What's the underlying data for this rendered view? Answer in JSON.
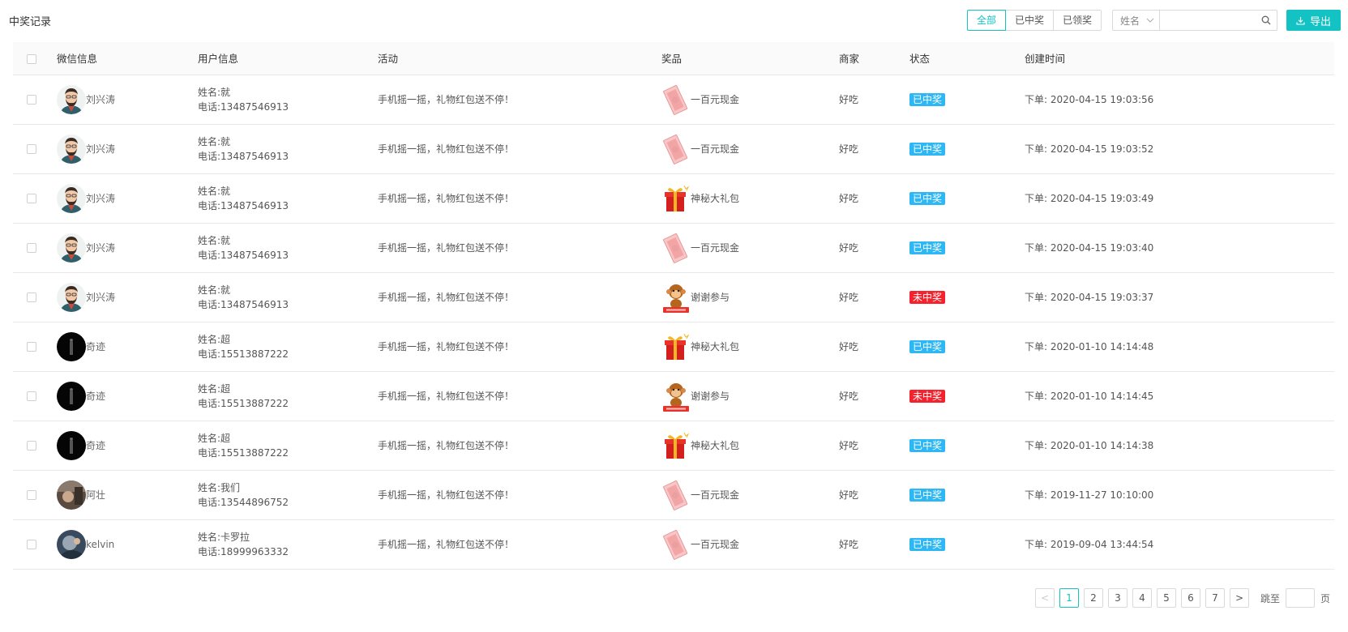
{
  "page": {
    "title": "中奖记录"
  },
  "filters": {
    "all": "全部",
    "won": "已中奖",
    "claimed": "已领奖"
  },
  "search": {
    "field_label": "姓名",
    "value": ""
  },
  "export_label": "导出",
  "table": {
    "headers": [
      "微信信息",
      "用户信息",
      "活动",
      "奖品",
      "商家",
      "状态",
      "创建时间"
    ],
    "rows": [
      {
        "wx_name": "刘兴涛",
        "avatar": "bearded-man",
        "name": "姓名:就",
        "phone": "电话:13487546913",
        "activity": "手机摇一摇，礼物红包送不停！",
        "prize": "一百元现金",
        "prize_icon": "cash-icon",
        "merchant": "好吃",
        "status": "已中奖",
        "status_type": "win",
        "time": "下单: 2020-04-15 19:03:56"
      },
      {
        "wx_name": "刘兴涛",
        "avatar": "bearded-man",
        "name": "姓名:就",
        "phone": "电话:13487546913",
        "activity": "手机摇一摇，礼物红包送不停！",
        "prize": "一百元现金",
        "prize_icon": "cash-icon",
        "merchant": "好吃",
        "status": "已中奖",
        "status_type": "win",
        "time": "下单: 2020-04-15 19:03:52"
      },
      {
        "wx_name": "刘兴涛",
        "avatar": "bearded-man",
        "name": "姓名:就",
        "phone": "电话:13487546913",
        "activity": "手机摇一摇，礼物红包送不停！",
        "prize": "神秘大礼包",
        "prize_icon": "gift-icon",
        "merchant": "好吃",
        "status": "已中奖",
        "status_type": "win",
        "time": "下单: 2020-04-15 19:03:49"
      },
      {
        "wx_name": "刘兴涛",
        "avatar": "bearded-man",
        "name": "姓名:就",
        "phone": "电话:13487546913",
        "activity": "手机摇一摇，礼物红包送不停！",
        "prize": "一百元现金",
        "prize_icon": "cash-icon",
        "merchant": "好吃",
        "status": "已中奖",
        "status_type": "win",
        "time": "下单: 2020-04-15 19:03:40"
      },
      {
        "wx_name": "刘兴涛",
        "avatar": "bearded-man",
        "name": "姓名:就",
        "phone": "电话:13487546913",
        "activity": "手机摇一摇，礼物红包送不停！",
        "prize": "谢谢参与",
        "prize_icon": "monkey-icon",
        "merchant": "好吃",
        "status": "未中奖",
        "status_type": "lose",
        "time": "下单: 2020-04-15 19:03:37"
      },
      {
        "wx_name": "奇迹",
        "avatar": "dark",
        "name": "姓名:超",
        "phone": "电话:15513887222",
        "activity": "手机摇一摇，礼物红包送不停！",
        "prize": "神秘大礼包",
        "prize_icon": "gift-icon",
        "merchant": "好吃",
        "status": "已中奖",
        "status_type": "win",
        "time": "下单: 2020-01-10 14:14:48"
      },
      {
        "wx_name": "奇迹",
        "avatar": "dark",
        "name": "姓名:超",
        "phone": "电话:15513887222",
        "activity": "手机摇一摇，礼物红包送不停！",
        "prize": "谢谢参与",
        "prize_icon": "monkey-icon",
        "merchant": "好吃",
        "status": "未中奖",
        "status_type": "lose",
        "time": "下单: 2020-01-10 14:14:45"
      },
      {
        "wx_name": "奇迹",
        "avatar": "dark",
        "name": "姓名:超",
        "phone": "电话:15513887222",
        "activity": "手机摇一摇，礼物红包送不停！",
        "prize": "神秘大礼包",
        "prize_icon": "gift-icon",
        "merchant": "好吃",
        "status": "已中奖",
        "status_type": "win",
        "time": "下单: 2020-01-10 14:14:38"
      },
      {
        "wx_name": "阿壮",
        "avatar": "photo-brown",
        "name": "姓名:我们",
        "phone": "电话:13544896752",
        "activity": "手机摇一摇，礼物红包送不停！",
        "prize": "一百元现金",
        "prize_icon": "cash-icon",
        "merchant": "好吃",
        "status": "已中奖",
        "status_type": "win",
        "time": "下单: 2019-11-27 10:10:00"
      },
      {
        "wx_name": "kelvin",
        "avatar": "photo-blue",
        "name": "姓名:卡罗拉",
        "phone": "电话:18999963332",
        "activity": "手机摇一摇，礼物红包送不停！",
        "prize": "一百元现金",
        "prize_icon": "cash-icon",
        "merchant": "好吃",
        "status": "已中奖",
        "status_type": "win",
        "time": "下单: 2019-09-04 13:44:54"
      }
    ]
  },
  "pagination": {
    "pages": [
      "1",
      "2",
      "3",
      "4",
      "5",
      "6",
      "7"
    ],
    "current": "1",
    "prev": "<",
    "next": ">",
    "jump_label": "跳至",
    "page_label": "页"
  },
  "colors": {
    "accent": "#13c2c2",
    "win": "#2db7f5",
    "lose": "#f5222d"
  }
}
